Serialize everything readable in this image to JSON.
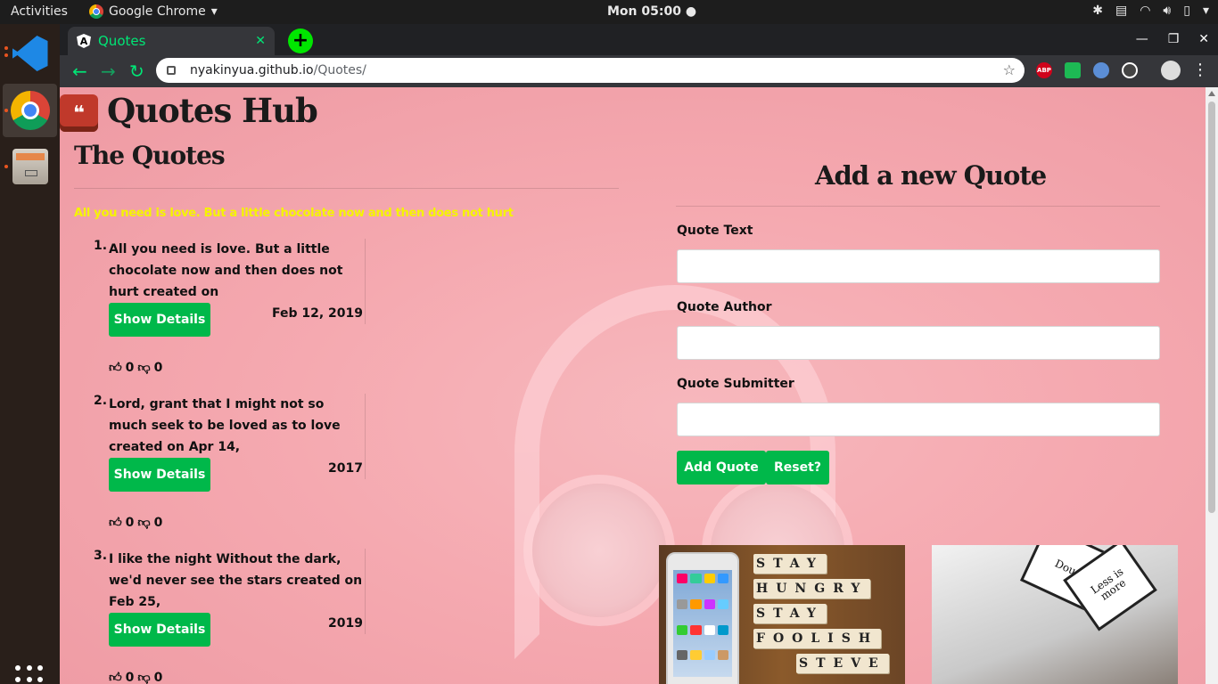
{
  "os": {
    "activities": "Activities",
    "app_menu": "Google Chrome",
    "clock": "Mon 05:00"
  },
  "browser": {
    "tab_title": "Quotes",
    "url_host": "nyakinyua.github.io",
    "url_path": "/Quotes/",
    "extensions": [
      "ABP"
    ]
  },
  "page": {
    "brand": "Quotes Hub",
    "section_title": "The Quotes",
    "highlight_quote": "All you need is love. But a little chocolate now and then does not hurt",
    "quotes": [
      {
        "number": "1.",
        "text": "All you need is love. But a little chocolate now and then does not hurt created on",
        "date": "Feb 12, 2019",
        "button": "Show Details",
        "upvotes": "0",
        "downvotes": "0"
      },
      {
        "number": "2.",
        "text": "Lord, grant that I might not so much seek to be loved as to love created on Apr 14,",
        "date": "2017",
        "button": "Show Details",
        "upvotes": "0",
        "downvotes": "0"
      },
      {
        "number": "3.",
        "text": "I like the night Without the dark, we'd never see the stars created on Feb 25,",
        "date": "2019",
        "button": "Show Details",
        "upvotes": "0",
        "downvotes": "0"
      }
    ],
    "form": {
      "title": "Add a new Quote",
      "text_label": "Quote Text",
      "author_label": "Quote Author",
      "submitter_label": "Quote Submitter",
      "add_button": "Add Quote",
      "reset_button": "Reset?"
    },
    "images": {
      "scrabble_rows": [
        "STAY",
        "HUNGRY",
        "STAY",
        "FOOLISH",
        "STEVE"
      ],
      "cards": [
        "Less is more",
        "Dou"
      ]
    }
  },
  "colors": {
    "accent_green": "#00b84a",
    "highlight_yellow": "#f5f500",
    "page_pink": "#f5a9b0"
  }
}
